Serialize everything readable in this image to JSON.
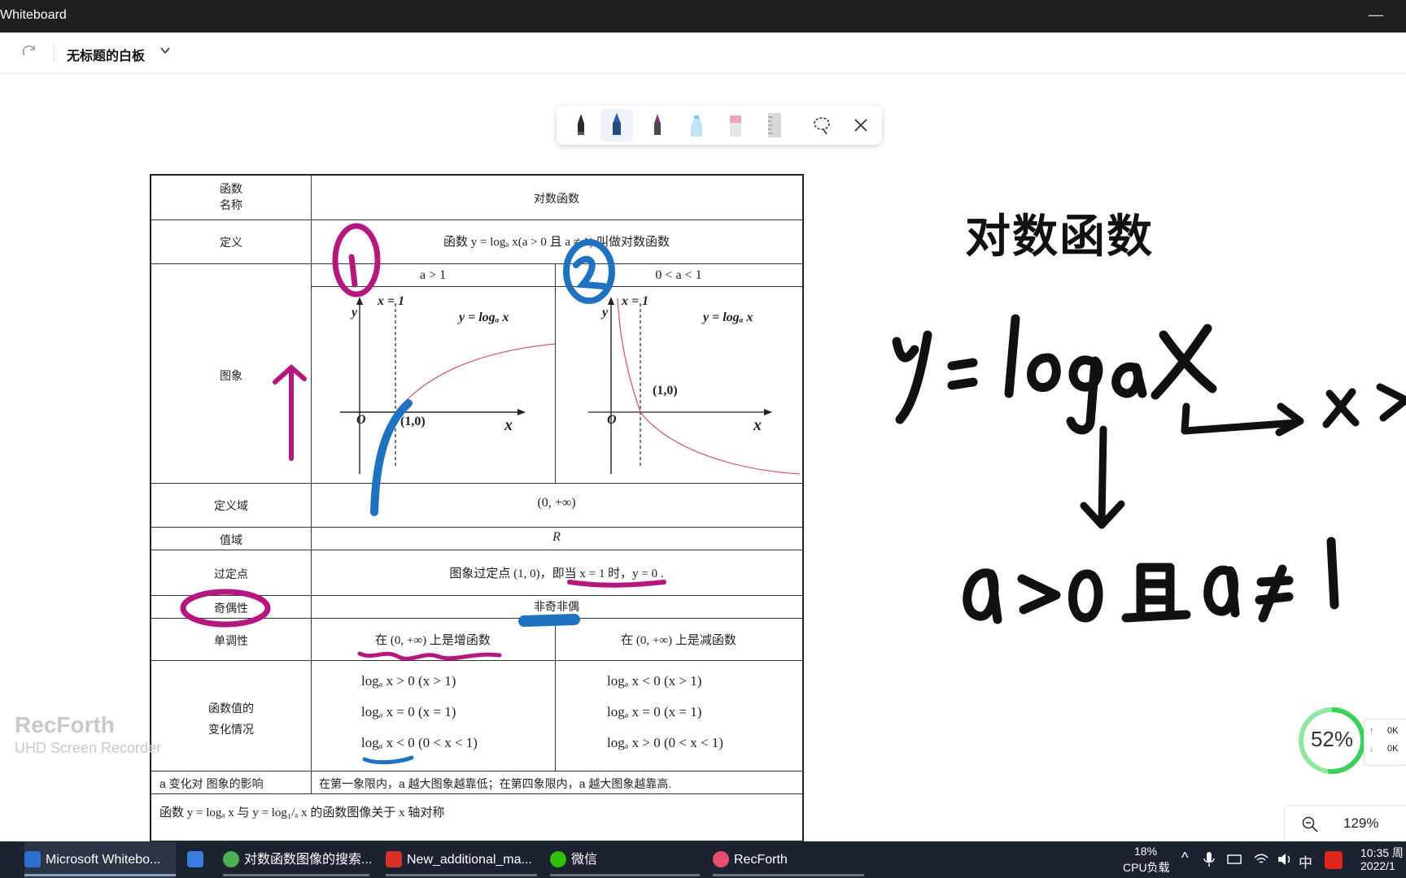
{
  "window": {
    "title": "Whiteboard",
    "minimize": "—"
  },
  "appbar": {
    "board_title": "无标题的白板"
  },
  "table": {
    "header_name": "函数\n名称",
    "header_value": "对数函数",
    "def_label": "定义",
    "def_value": "函数 y = logₐ x(a > 0 且 a ≠ 1) 叫做对数函数",
    "graph_label": "图象",
    "col_a_gt1": "a > 1",
    "col_a_lt1": "0 < a < 1",
    "graph1_x1": "x = 1",
    "graph1_fn": "y = logₐ x",
    "graph1_point": "(1,0)",
    "graph1_o": "O",
    "graph1_xaxis": "x",
    "graph1_yaxis": "y",
    "graph2_x1": "x = 1",
    "graph2_fn": "y = logₐ x",
    "graph2_point": "(1,0)",
    "graph2_o": "O",
    "graph2_xaxis": "x",
    "graph2_yaxis": "y",
    "domain_label": "定义域",
    "domain_value": "(0, +∞)",
    "range_label": "值域",
    "range_value": "R",
    "fixed_label": "过定点",
    "fixed_value": "图象过定点 (1, 0)，即当 x = 1 时，y = 0 .",
    "parity_label": "奇偶性",
    "parity_value": "非奇非偶",
    "mono_label": "单调性",
    "mono_inc": "在 (0, +∞) 上是增函数",
    "mono_dec": "在 (0, +∞) 上是减函数",
    "values_label": "函数值的\n变化情况",
    "values_left": [
      "logₐ x > 0  (x > 1)",
      "logₐ x = 0  (x = 1)",
      "logₐ x < 0  (0 < x < 1)"
    ],
    "values_right": [
      "logₐ x < 0  (x > 1)",
      "logₐ x = 0  (x = 1)",
      "logₐ x > 0  (0 < x < 1)"
    ],
    "effect_label": "a 变化对 图象的影响",
    "effect_value": "在第一象限内，a 越大图象越靠低；在第四象限内，a 越大图象越靠高.",
    "symmetry": "函数 y = logₐ x 与 y = log₁/ₐ x 的函数图像关于 x 轴对称"
  },
  "board": {
    "big_title": "对数函数"
  },
  "watermark": {
    "line1": "RecForth",
    "line2": "UHD Screen Recorder"
  },
  "cpu_widget": {
    "percent": "52%",
    "up": "0K",
    "down": "0K"
  },
  "zoom": {
    "level": "129%"
  },
  "taskbar": {
    "items": [
      {
        "label": "Microsoft Whitebo...",
        "color": "#2f6fd1"
      },
      {
        "label": "",
        "color": "#3b7ddd"
      },
      {
        "label": "对数函数图像的搜索...",
        "color": "#4caf50"
      },
      {
        "label": "New_additional_ma...",
        "color": "#d9302c"
      },
      {
        "label": "微信",
        "color": "#2dc100"
      },
      {
        "label": "RecForth",
        "color": "#e84d6b"
      }
    ],
    "cpu": "18%",
    "cpu_label": "CPU负载",
    "ime": "中",
    "time": "10:35 周",
    "date": "2022/1"
  }
}
